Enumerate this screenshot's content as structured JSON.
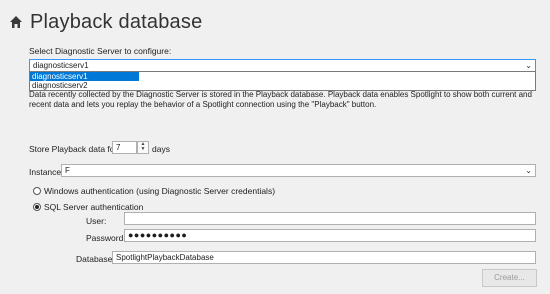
{
  "page": {
    "title": "Playback database"
  },
  "server": {
    "label": "Select Diagnostic Server to configure:",
    "selected": "diagnosticserv1",
    "options": [
      "diagnosticserv1",
      "diagnosticserv2"
    ]
  },
  "description": "Data recently collected by the Diagnostic Server is stored in the Playback database. Playback data enables Spotlight to show both current and recent data and lets you replay the behavior of a Spotlight connection using the \"Playback\" button.",
  "store": {
    "label": "Store Playback data for",
    "value": "7",
    "unit": "days"
  },
  "instance": {
    "label": "Instance:",
    "value": "F"
  },
  "auth": {
    "windows_label": "Windows authentication (using Diagnostic Server credentials)",
    "sql_label": "SQL Server authentication",
    "selected": "sql"
  },
  "user": {
    "label": "User:",
    "value": ""
  },
  "password": {
    "label": "Password:",
    "value": "●●●●●●●●●●"
  },
  "database": {
    "label": "Database:",
    "value": "SpotlightPlaybackDatabase"
  },
  "buttons": {
    "create": "Create..."
  }
}
